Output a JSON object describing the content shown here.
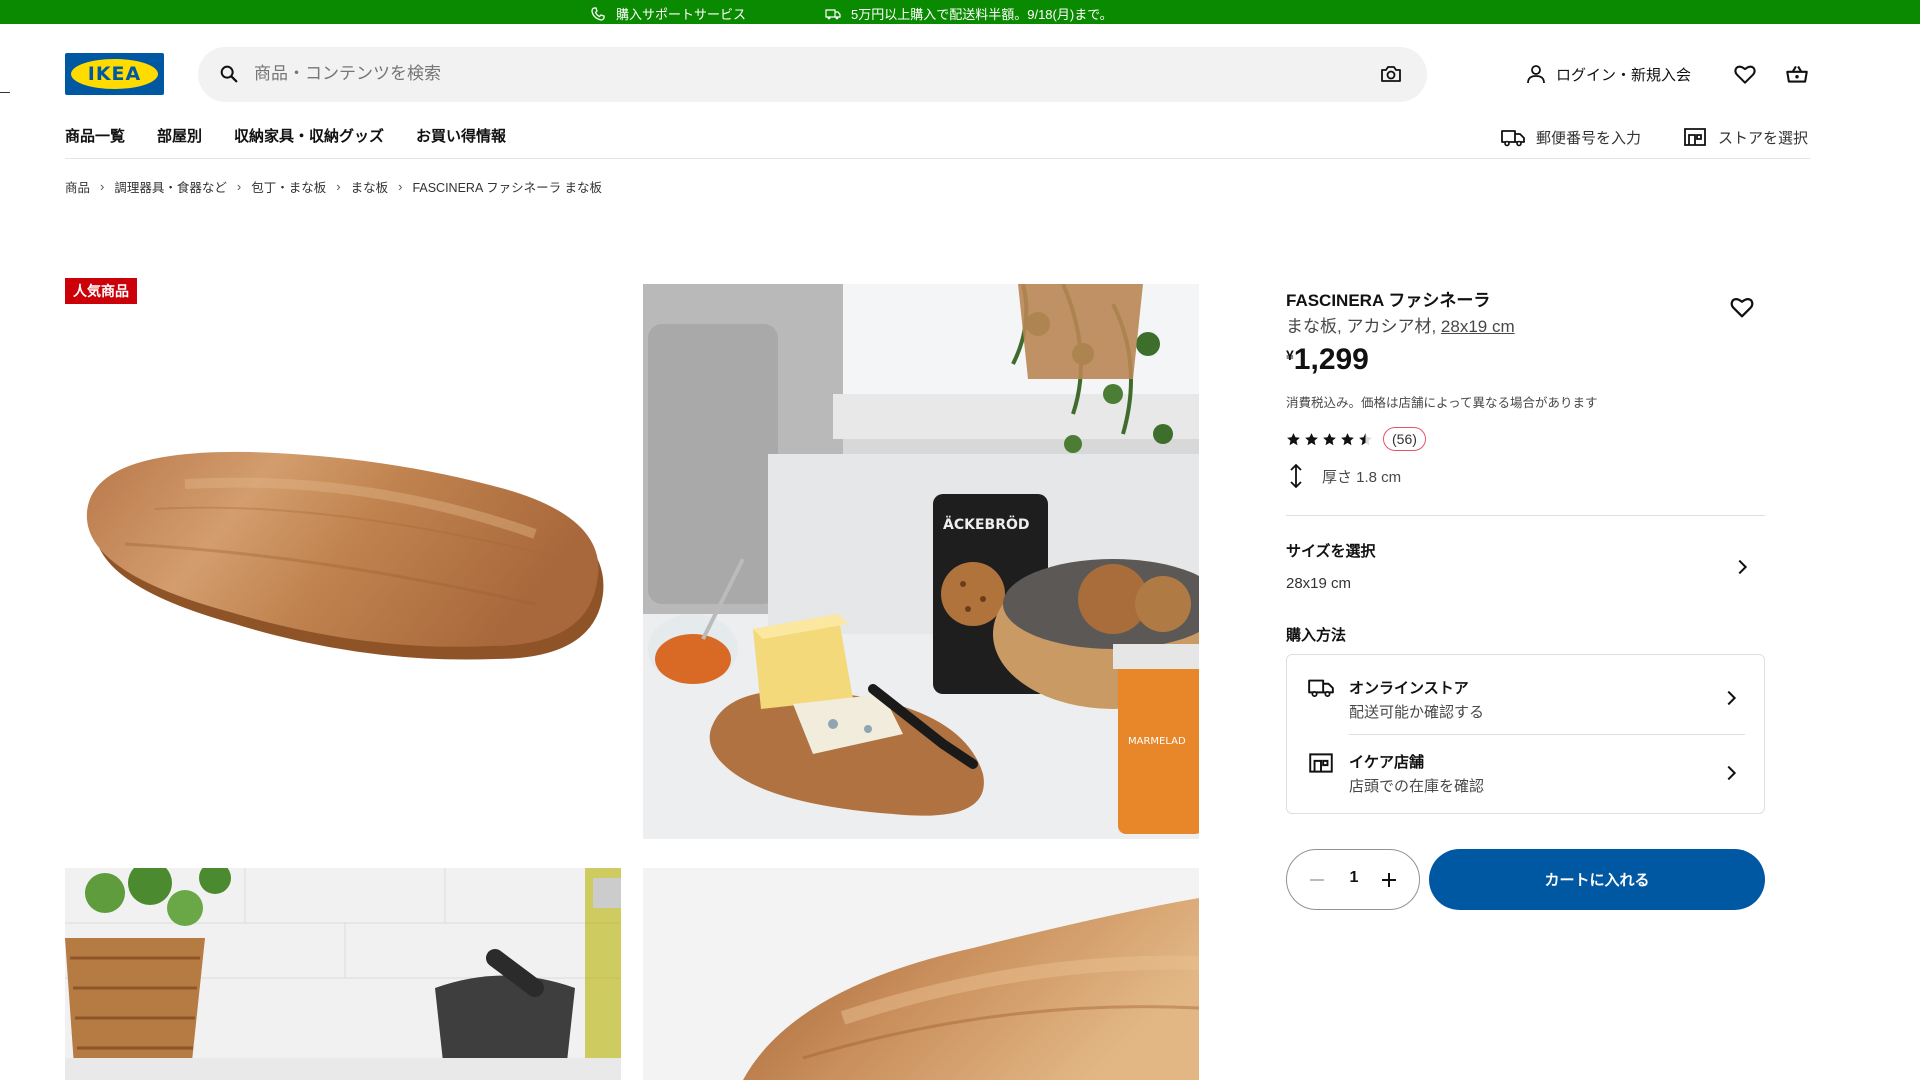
{
  "topbar": {
    "support": "購入サポートサービス",
    "shipping": "5万円以上購入で配送料半額。9/18(月)まで。",
    "bg_color": "#0a8a00"
  },
  "header": {
    "logo_text": "IKEA",
    "search_placeholder": "商品・コンテンツを検索",
    "login_label": "ログイン・新規入会"
  },
  "nav": {
    "items": [
      "商品一覧",
      "部屋別",
      "収納家具・収納グッズ",
      "お買い得情報"
    ],
    "postcode_label": "郵便番号を入力",
    "store_label": "ストアを選択"
  },
  "breadcrumb": [
    "商品",
    "調理器具・食器など",
    "包丁・まな板",
    "まな板",
    "FASCINERA ファシネーラ まな板"
  ],
  "badge": "人気商品",
  "product": {
    "name": "FASCINERA ファシネーラ",
    "desc": "まな板, アカシア材, ",
    "size_link": "28x19 cm",
    "currency": "¥",
    "price": "1,299",
    "tax_note": "消費税込み。価格は店舗によって異なる場合があります",
    "rating": 4.5,
    "review_count": "(56)",
    "thickness": "厚さ 1.8 cm"
  },
  "size_select": {
    "label": "サイズを選択",
    "value": "28x19 cm"
  },
  "purchase": {
    "heading": "購入方法",
    "online_title": "オンラインストア",
    "online_sub": "配送可能か確認する",
    "store_title": "イケア店舗",
    "store_sub": "店頭での在庫を確認"
  },
  "cart": {
    "quantity": "1",
    "add_label": "カートに入れる",
    "button_color": "#0058a3"
  }
}
